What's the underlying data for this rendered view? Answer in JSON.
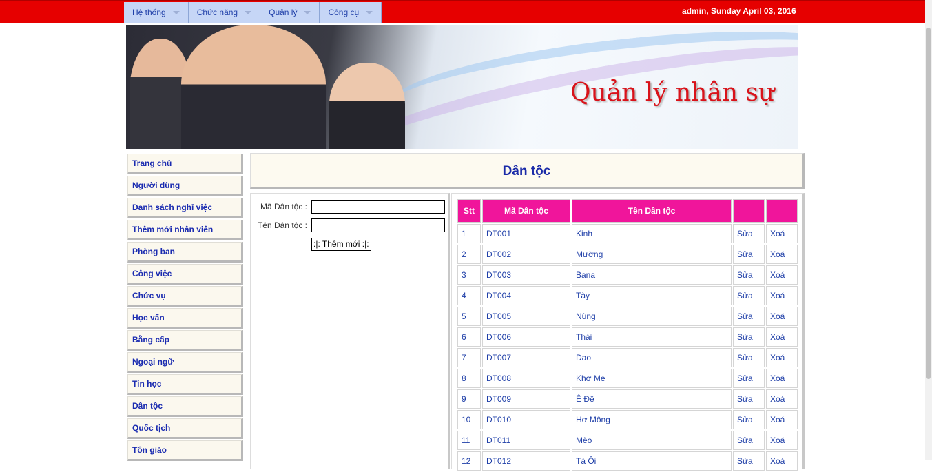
{
  "menu": {
    "items": [
      {
        "label": "Hệ thống"
      },
      {
        "label": "Chức năng"
      },
      {
        "label": "Quản lý"
      },
      {
        "label": "Công cụ"
      }
    ],
    "user_info": "admin, Sunday April 03, 2016"
  },
  "banner": {
    "title": "Quản lý nhân sự"
  },
  "sidebar": {
    "items": [
      {
        "label": "Trang chủ"
      },
      {
        "label": "Người dùng"
      },
      {
        "label": "Danh sách nghỉ việc"
      },
      {
        "label": "Thêm mới nhân viên"
      },
      {
        "label": "Phòng ban"
      },
      {
        "label": "Công việc"
      },
      {
        "label": "Chức vụ"
      },
      {
        "label": "Học vấn"
      },
      {
        "label": "Bằng cấp"
      },
      {
        "label": "Ngoại ngữ"
      },
      {
        "label": "Tin học"
      },
      {
        "label": "Dân tộc"
      },
      {
        "label": "Quốc tịch"
      },
      {
        "label": "Tôn giáo"
      }
    ]
  },
  "page": {
    "title": "Dân tộc"
  },
  "form": {
    "code_label": "Mã Dân tộc :",
    "code_value": "",
    "name_label": "Tên Dân tộc :",
    "name_value": "",
    "add_button": ":|: Thêm mới :|:"
  },
  "table": {
    "headers": [
      "Stt",
      "Mã Dân tộc",
      "Tên Dân tộc",
      "",
      ""
    ],
    "rows": [
      {
        "stt": "1",
        "code": "DT001",
        "name": "Kinh",
        "edit": "Sửa",
        "delete": "Xoá"
      },
      {
        "stt": "2",
        "code": "DT002",
        "name": "Mường",
        "edit": "Sửa",
        "delete": "Xoá"
      },
      {
        "stt": "3",
        "code": "DT003",
        "name": "Bana",
        "edit": "Sửa",
        "delete": "Xoá"
      },
      {
        "stt": "4",
        "code": "DT004",
        "name": "Tày",
        "edit": "Sửa",
        "delete": "Xoá"
      },
      {
        "stt": "5",
        "code": "DT005",
        "name": "Nùng",
        "edit": "Sửa",
        "delete": "Xoá"
      },
      {
        "stt": "6",
        "code": "DT006",
        "name": "Thái",
        "edit": "Sửa",
        "delete": "Xoá"
      },
      {
        "stt": "7",
        "code": "DT007",
        "name": "Dao",
        "edit": "Sửa",
        "delete": "Xoá"
      },
      {
        "stt": "8",
        "code": "DT008",
        "name": "Khơ Me",
        "edit": "Sửa",
        "delete": "Xoá"
      },
      {
        "stt": "9",
        "code": "DT009",
        "name": "Ê Đê",
        "edit": "Sửa",
        "delete": "Xoá"
      },
      {
        "stt": "10",
        "code": "DT010",
        "name": "Hơ Mông",
        "edit": "Sửa",
        "delete": "Xoá"
      },
      {
        "stt": "11",
        "code": "DT011",
        "name": "Mèo",
        "edit": "Sửa",
        "delete": "Xoá"
      },
      {
        "stt": "12",
        "code": "DT012",
        "name": "Tà Ôi",
        "edit": "Sửa",
        "delete": "Xoá"
      }
    ]
  }
}
